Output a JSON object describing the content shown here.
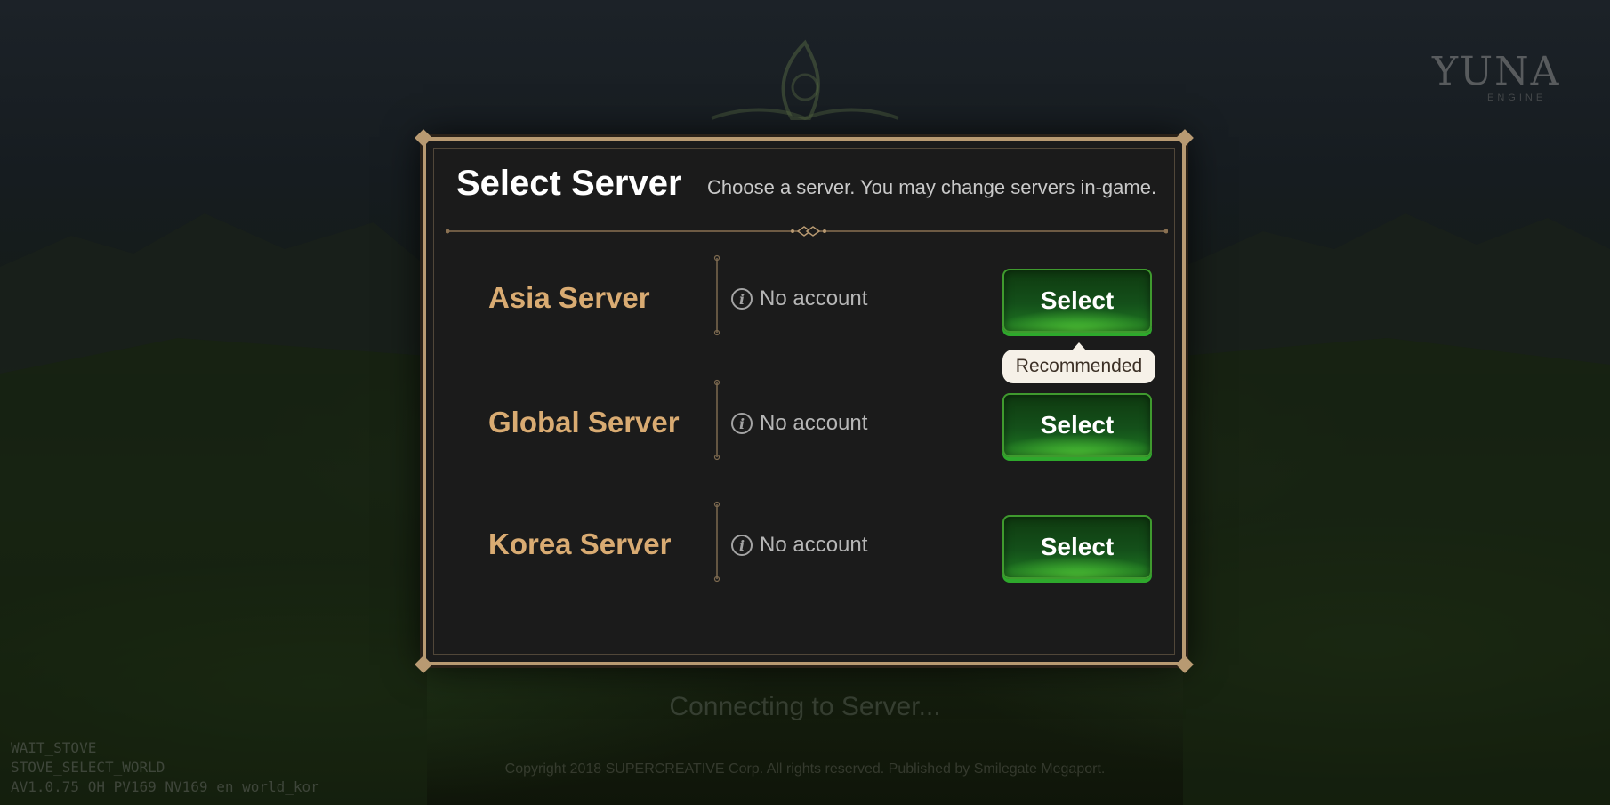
{
  "background": {
    "brand_logo": "YUNA",
    "brand_logo_sub": "ENGINE",
    "status_text": "Connecting to Server...",
    "copyright": "Copyright 2018 SUPERCREATIVE Corp. All rights reserved. Published by Smilegate Megaport.",
    "debug_lines": [
      "WAIT_STOVE",
      "STOVE_SELECT_WORLD",
      "AV1.0.75 OH PV169 NV169 en world_kor"
    ]
  },
  "dialog": {
    "title": "Select Server",
    "subtitle": "Choose a server. You may change servers in-game.",
    "servers": [
      {
        "name": "Asia Server",
        "status": "No account",
        "button_label": "Select",
        "badge": "Recommended"
      },
      {
        "name": "Global Server",
        "status": "No account",
        "button_label": "Select"
      },
      {
        "name": "Korea Server",
        "status": "No account",
        "button_label": "Select"
      }
    ]
  },
  "colors": {
    "frame_gold": "#b89a72",
    "server_name": "#d9ab72",
    "button_green": "#1f7a22",
    "panel_bg": "#1b1b1b"
  },
  "icons": [
    "info-icon"
  ]
}
